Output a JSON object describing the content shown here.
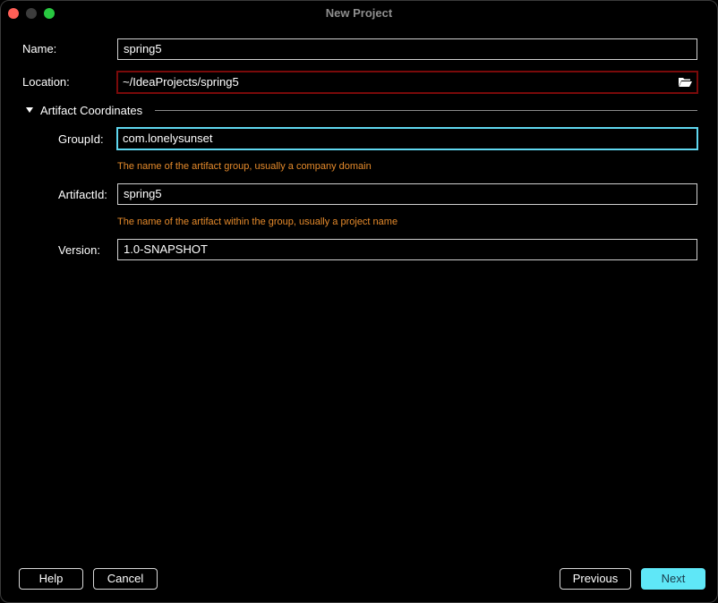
{
  "window": {
    "title": "New Project"
  },
  "form": {
    "name_label": "Name:",
    "name_value": "spring5",
    "location_label": "Location:",
    "location_value": "~/IdeaProjects/spring5",
    "section_title": "Artifact Coordinates",
    "groupid_label": "GroupId:",
    "groupid_value": "com.lonelysunset",
    "groupid_hint": "The name of the artifact group, usually a company domain",
    "artifactid_label": "ArtifactId:",
    "artifactid_value": "spring5",
    "artifactid_hint": "The name of the artifact within the group, usually a project name",
    "version_label": "Version:",
    "version_value": "1.0-SNAPSHOT"
  },
  "buttons": {
    "help": "Help",
    "cancel": "Cancel",
    "previous": "Previous",
    "next": "Next"
  },
  "icons": {
    "browse": "folder-open-icon",
    "section_toggle": "triangle-down-icon"
  },
  "colors": {
    "focus": "#5fd7ef",
    "error": "#7a0a0a",
    "hint": "#e58a2b",
    "primary_button": "#5fe7f7"
  }
}
